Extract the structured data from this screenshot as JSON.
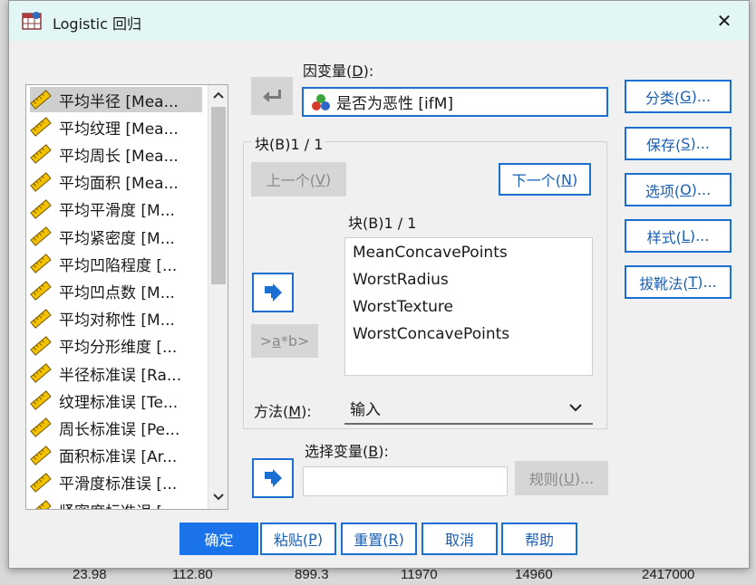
{
  "background": {
    "top_row": [
      "23.98",
      "112.80",
      "899.3",
      "11970",
      "14960",
      "2417000"
    ]
  },
  "window": {
    "title": "Logistic 回归",
    "close_symbol": "✕"
  },
  "variables": [
    {
      "label": "平均半径 [Mea...",
      "selected": true
    },
    {
      "label": "平均纹理 [Mea..."
    },
    {
      "label": "平均周长 [Mea..."
    },
    {
      "label": "平均面积 [Mea..."
    },
    {
      "label": "平均平滑度 [M..."
    },
    {
      "label": "平均紧密度 [M..."
    },
    {
      "label": "平均凹陷程度 [..."
    },
    {
      "label": "平均凹点数 [M..."
    },
    {
      "label": "平均对称性 [M..."
    },
    {
      "label": "平均分形维度 [..."
    },
    {
      "label": "半径标准误 [Ra..."
    },
    {
      "label": "纹理标准误 [Te..."
    },
    {
      "label": "周长标准误 [Pe..."
    },
    {
      "label": "面积标准误 [Ar..."
    },
    {
      "label": "平滑度标准误 [..."
    },
    {
      "label": "紧密度标准误 [..."
    }
  ],
  "dependent": {
    "label": "因变量(",
    "mnemonic": "D",
    "label_end": "):",
    "value": "是否为恶性 [ifM]"
  },
  "block": {
    "group_title": "块(B)1 / 1",
    "prev_button": "上一个(",
    "prev_mnemonic": "V",
    "next_button": "下一个(",
    "next_mnemonic": "N",
    "inner_label": "块(B)1 / 1",
    "covariates": [
      "MeanConcavePoints",
      "WorstRadius",
      "WorstTexture",
      "WorstConcavePoints"
    ],
    "interaction_button_prefix": ">",
    "interaction_button_a": "a",
    "interaction_button_rest": "*b>"
  },
  "method": {
    "label": "方法(",
    "mnemonic": "M",
    "label_end": "):",
    "value": "输入"
  },
  "selection": {
    "label": "选择变量(",
    "mnemonic": "B",
    "label_end": "):",
    "value": "",
    "rule_button": "规则(",
    "rule_mnemonic": "U",
    "rule_end": ")..."
  },
  "side_buttons": [
    {
      "pre": "分类(",
      "m": "G",
      "post": ")..."
    },
    {
      "pre": "保存(",
      "m": "S",
      "post": ")..."
    },
    {
      "pre": "选项(",
      "m": "O",
      "post": ")..."
    },
    {
      "pre": "样式(",
      "m": "L",
      "post": ")..."
    },
    {
      "pre": "拔靴法(",
      "m": "T",
      "post": ")..."
    }
  ],
  "bottom_buttons": {
    "ok": "确定",
    "paste_pre": "粘贴(",
    "paste_m": "P",
    "paste_post": ")",
    "reset_pre": "重置(",
    "reset_m": "R",
    "reset_post": ")",
    "cancel": "取消",
    "help": "帮助"
  },
  "colors": {
    "accent": "#1a6fd0",
    "primary_button": "#1a73e8",
    "titlebar": "#e3f6f6"
  }
}
